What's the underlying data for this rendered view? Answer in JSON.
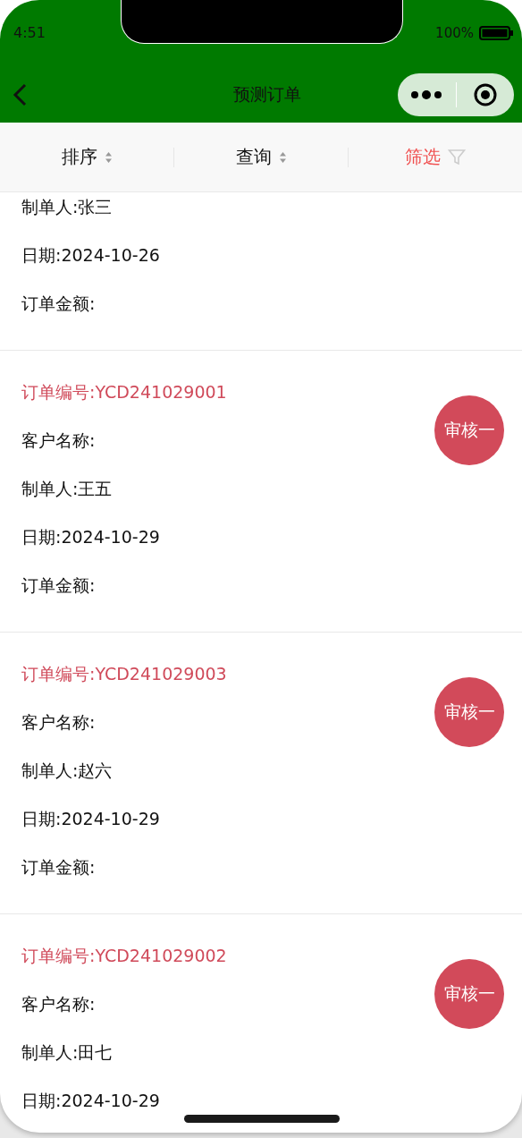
{
  "status_bar": {
    "time": "4:51",
    "battery": "100%"
  },
  "nav": {
    "title": "预测订单"
  },
  "toolbar": [
    {
      "label": "排序",
      "kind": "sort",
      "active": false
    },
    {
      "label": "查询",
      "kind": "sort",
      "active": false
    },
    {
      "label": "筛选",
      "kind": "filter",
      "active": true
    }
  ],
  "orders": [
    {
      "fields": [
        "制单人:张三",
        "日期:2024-10-26",
        "订单金额:"
      ]
    },
    {
      "order_no": "订单编号:YCD241029001",
      "fields": [
        "客户名称:",
        "制单人:王五",
        "日期:2024-10-29",
        "订单金额:"
      ],
      "action": "审核一"
    },
    {
      "order_no": "订单编号:YCD241029003",
      "fields": [
        "客户名称:",
        "制单人:赵六",
        "日期:2024-10-29",
        "订单金额:"
      ],
      "action": "审核一"
    },
    {
      "order_no": "订单编号:YCD241029002",
      "fields": [
        "客户名称:",
        "制单人:田七",
        "日期:2024-10-29"
      ],
      "action": "审核一"
    }
  ]
}
